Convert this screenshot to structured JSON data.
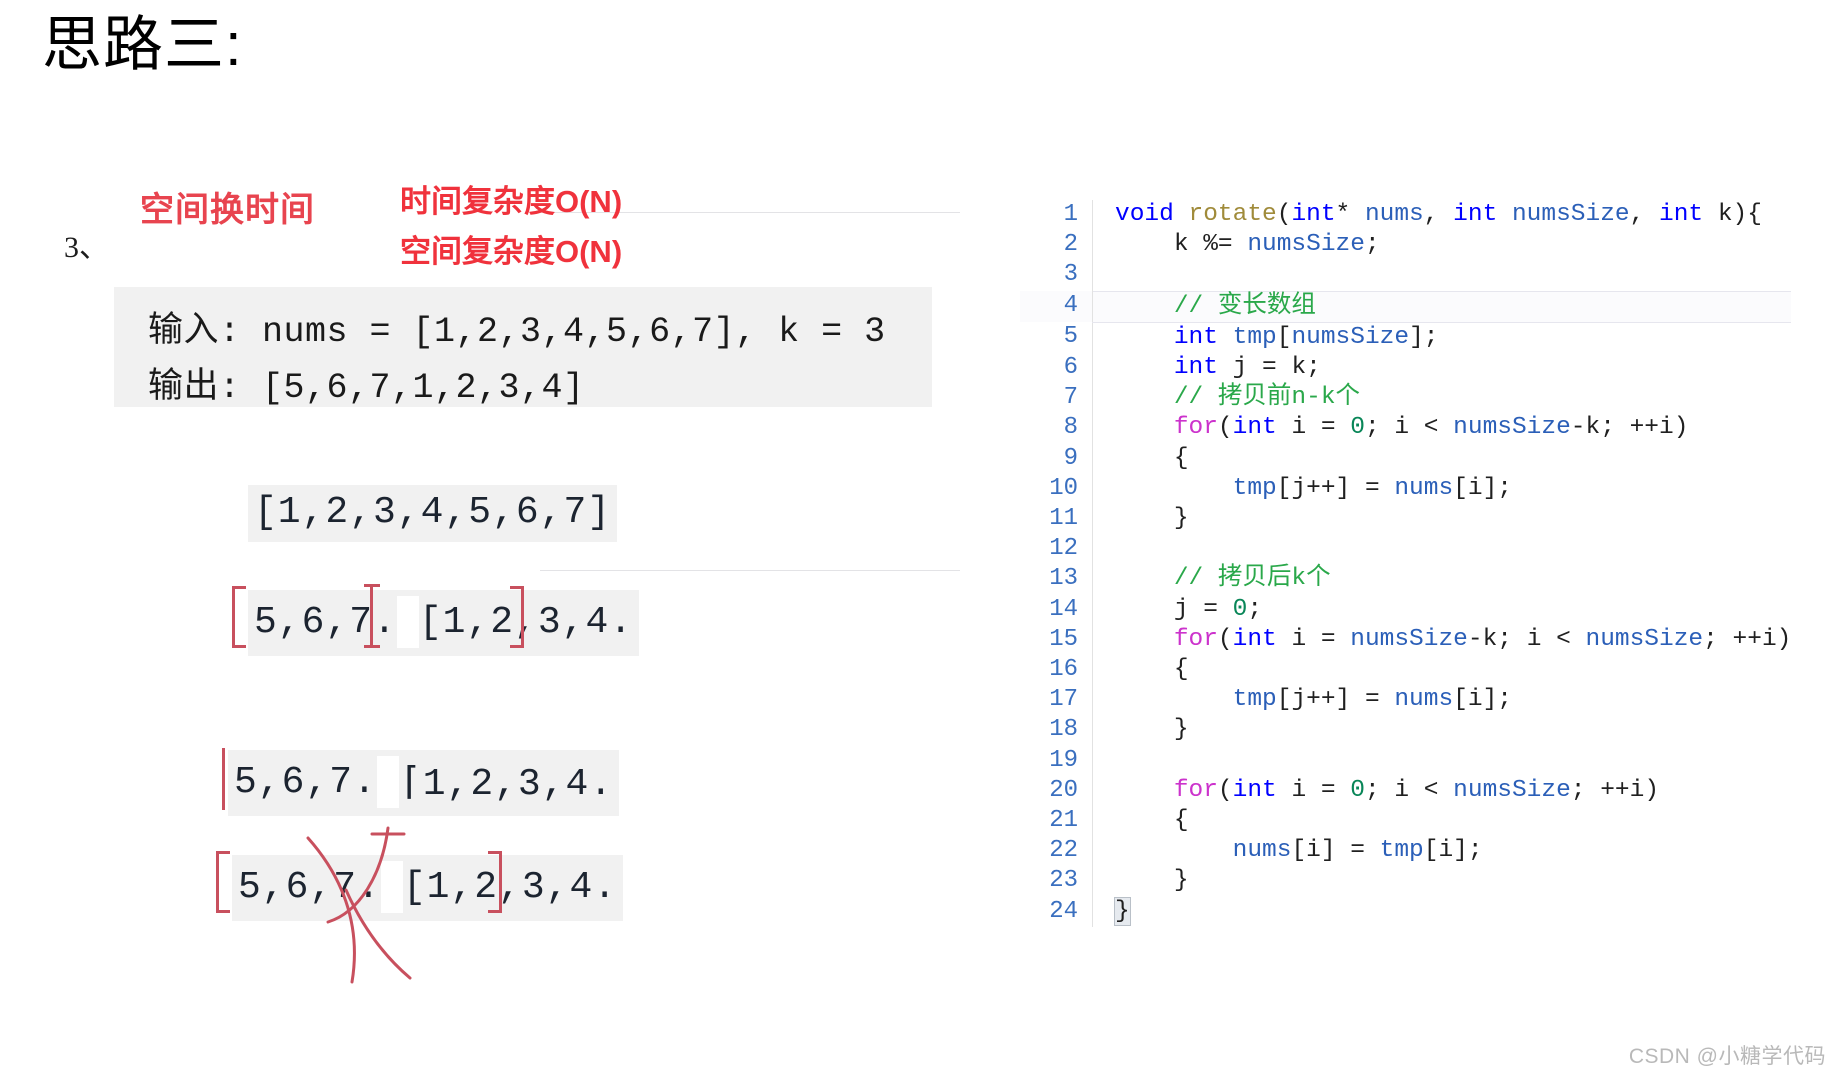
{
  "slide": {
    "title": "思路三:"
  },
  "left": {
    "item_number": "3、",
    "space_for_time": "空间换时间",
    "time_complexity": "时间复杂度O(N)",
    "space_complexity": "空间复杂度O(N)",
    "io": {
      "input_line": "输入: nums = [1,2,3,4,5,6,7], k = 3",
      "output_line": "输出: [5,6,7,1,2,3,4]"
    },
    "steps": [
      {
        "left": "[1,2,3,4,5,6,7]",
        "right": ""
      },
      {
        "left": "5,6,7.",
        "right": "[1,2,3,4."
      },
      {
        "left": "5,6,7.",
        "right": "⌈1,2,3,4."
      },
      {
        "left": "5,6,7.",
        "right": "[1,2,3,4."
      }
    ],
    "annotation": "red-cross-out"
  },
  "code": {
    "language": "C",
    "lines": [
      {
        "n": "1",
        "text": "void rotate(int* nums, int numsSize, int k){"
      },
      {
        "n": "2",
        "text": "    k %= numsSize;"
      },
      {
        "n": "3",
        "text": ""
      },
      {
        "n": "4",
        "text": "    // 变长数组"
      },
      {
        "n": "5",
        "text": "    int tmp[numsSize];"
      },
      {
        "n": "6",
        "text": "    int j = k;"
      },
      {
        "n": "7",
        "text": "    // 拷贝前n-k个"
      },
      {
        "n": "8",
        "text": "    for(int i = 0; i < numsSize-k; ++i)"
      },
      {
        "n": "9",
        "text": "    {"
      },
      {
        "n": "10",
        "text": "        tmp[j++] = nums[i];"
      },
      {
        "n": "11",
        "text": "    }"
      },
      {
        "n": "12",
        "text": ""
      },
      {
        "n": "13",
        "text": "    // 拷贝后k个"
      },
      {
        "n": "14",
        "text": "    j = 0;"
      },
      {
        "n": "15",
        "text": "    for(int i = numsSize-k; i < numsSize; ++i)"
      },
      {
        "n": "16",
        "text": "    {"
      },
      {
        "n": "17",
        "text": "        tmp[j++] = nums[i];"
      },
      {
        "n": "18",
        "text": "    }"
      },
      {
        "n": "19",
        "text": ""
      },
      {
        "n": "20",
        "text": "    for(int i = 0; i < numsSize; ++i)"
      },
      {
        "n": "21",
        "text": "    {"
      },
      {
        "n": "22",
        "text": "        nums[i] = tmp[i];"
      },
      {
        "n": "23",
        "text": "    }"
      },
      {
        "n": "24",
        "text": "}"
      }
    ],
    "highlighted_line": "4",
    "brace_match_line": "24"
  },
  "watermark": "CSDN @小糖学代码",
  "colors": {
    "accent_red": "#e8444f",
    "complexity_red": "#f0323c",
    "annotation_red": "#c8505e",
    "comment_green": "#2aa84a",
    "keyword_blue": "#0000ff",
    "control_magenta": "#cc33cc",
    "linenumber_blue": "#3a6fbf",
    "band_gray": "#f1f1f1"
  }
}
